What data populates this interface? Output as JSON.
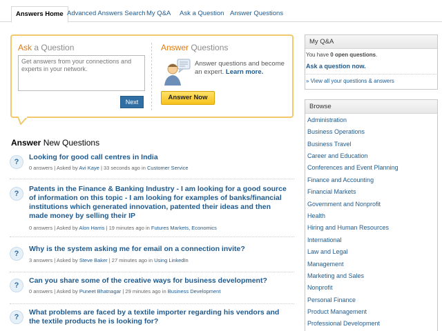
{
  "tabs": [
    {
      "label": "Answers Home",
      "active": true
    },
    {
      "label": "Advanced Answers Search",
      "active": false
    },
    {
      "label": "My Q&A",
      "active": false
    },
    {
      "label": "Ask a Question",
      "active": false
    },
    {
      "label": "Answer Questions",
      "active": false
    }
  ],
  "ask": {
    "title_accent": "Ask",
    "title_rest": " a Question",
    "placeholder": "Get answers from your connections and experts in your network.",
    "next_label": "Next"
  },
  "answer": {
    "title_accent": "Answer",
    "title_rest": " Questions",
    "description": "Answer questions and become an expert.",
    "learn_more": "Learn more.",
    "button_label": "Answer Now"
  },
  "questions_heading": {
    "bold": "Answer",
    "rest": " New Questions"
  },
  "questions": [
    {
      "title": "Looking for good call centres in India",
      "answers": "0 answers | Asked by ",
      "author": "Avi Kaye",
      "time": " | 33 seconds ago in ",
      "category": "Customer Service"
    },
    {
      "title": "Patents in the Finance & Banking Industry - I am looking for a good source of information on this topic - I am looking for examples of banks/financial institutions which generated innovation, patented their ideas and then made money by selling their IP",
      "answers": "0 answers | Asked by ",
      "author": "Alon Harris",
      "time": " | 19 minutes ago in ",
      "category": "Futures Markets, Economics"
    },
    {
      "title": "Why is the system asking me for email on a connection invite?",
      "answers": "3 answers | Asked by ",
      "author": "Steve Baker",
      "time": " | 27 minutes ago in ",
      "category": "Using LinkedIn"
    },
    {
      "title": "Can you share some of the creative ways for business development?",
      "answers": "0 answers | Asked by ",
      "author": "Puneet Bhatnagar",
      "time": " | 29 minutes ago in ",
      "category": "Business Development"
    },
    {
      "title": "What problems are faced by a textile importer regarding his vendors and the textile products he is looking for?",
      "answers": "",
      "author": "",
      "time": "",
      "category": ""
    }
  ],
  "myqa": {
    "title": "My Q&A",
    "status_prefix": "You have ",
    "status_count": "0 open questions",
    "status_suffix": ".",
    "ask_link": "Ask a question now.",
    "view_all": "» View all your questions & answers"
  },
  "browse": {
    "title": "Browse",
    "items": [
      "Administration",
      "Business Operations",
      "Business Travel",
      "Career and Education",
      "Conferences and Event Planning",
      "Finance and Accounting",
      "Financial Markets",
      "Government and Nonprofit",
      "Health",
      "Hiring and Human Resources",
      "International",
      "Law and Legal",
      "Management",
      "Marketing and Sales",
      "Nonprofit",
      "Personal Finance",
      "Product Management",
      "Professional Development"
    ]
  }
}
